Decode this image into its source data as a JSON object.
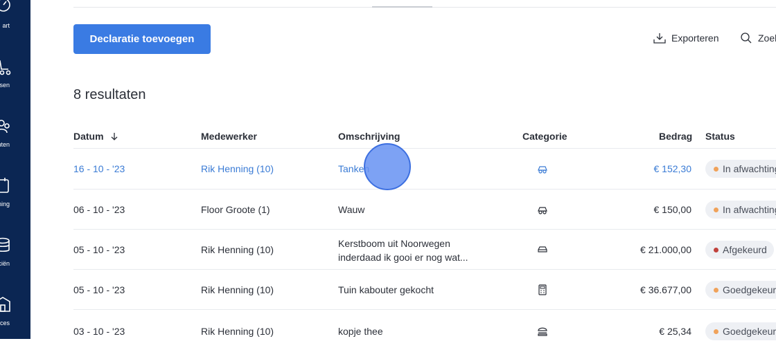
{
  "sidebar": {
    "items": [
      {
        "label": "art",
        "icon": "dashboard-icon"
      },
      {
        "label": "ssen",
        "icon": "cart-icon"
      },
      {
        "label": "nten",
        "icon": "users-icon"
      },
      {
        "label": "ning",
        "icon": "calendar-icon"
      },
      {
        "label": "nciën",
        "icon": "coins-icon"
      },
      {
        "label": "urces",
        "icon": "building-icon"
      }
    ]
  },
  "toolbar": {
    "add_label": "Declaratie toevoegen",
    "export_label": "Exporteren",
    "search_label": "Zoek"
  },
  "results_label": "8 resultaten",
  "table": {
    "headers": {
      "date": "Datum",
      "employee": "Medewerker",
      "description": "Omschrijving",
      "category": "Categorie",
      "amount": "Bedrag",
      "status": "Status"
    },
    "rows": [
      {
        "date": "16 - 10 - '23",
        "employee": "Rik Henning (10)",
        "description": "Tanken",
        "category_icon": "car-front-icon",
        "amount": "€ 152,30",
        "status": "In afwachting",
        "status_color": "#f0a25a"
      },
      {
        "date": "06 - 10 - '23",
        "employee": "Floor Groote (1)",
        "description": "Wauw",
        "category_icon": "car-front-icon",
        "amount": "€ 150,00",
        "status": "In afwachting",
        "status_color": "#f0a25a"
      },
      {
        "date": "05 - 10 - '23",
        "employee": "Rik Henning (10)",
        "description": "Kerstboom uit Noorwegen inderdaad ik gooi er nog wat...",
        "category_icon": "car-icon",
        "amount": "€ 21.000,00",
        "status": "Afgekeurd",
        "status_color": "#c0413c"
      },
      {
        "date": "05 - 10 - '23",
        "employee": "Rik Henning (10)",
        "description": "Tuin kabouter gekocht",
        "category_icon": "calculator-icon",
        "amount": "€ 36.677,00",
        "status": "Goedgekeurd",
        "status_color": "#f0a25a"
      },
      {
        "date": "03 - 10 - '23",
        "employee": "Rik Henning (10)",
        "description": "kopje thee",
        "category_icon": "food-icon",
        "amount": "€ 25,34",
        "status": "Goedgekeurd",
        "status_color": "#f0a25a"
      }
    ]
  },
  "colors": {
    "primary": "#3a7be3",
    "sidebar": "#0b2653",
    "link": "#3a7bd5"
  }
}
